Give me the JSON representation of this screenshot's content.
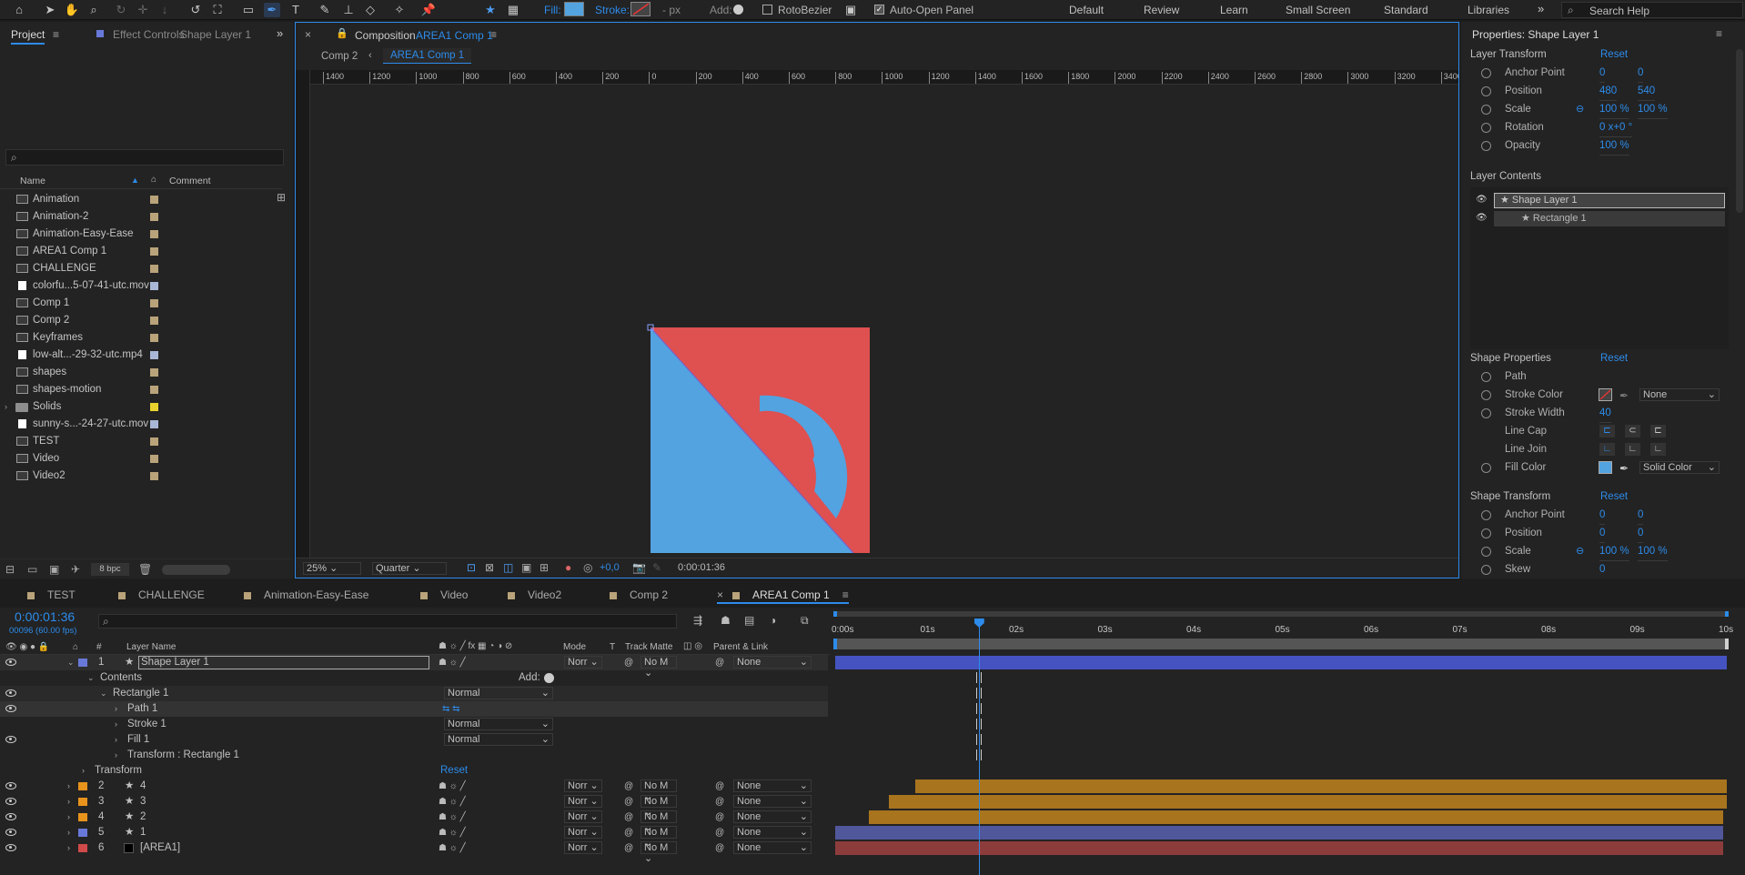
{
  "toolbar": {
    "fill_label": "Fill:",
    "stroke_label": "Stroke:",
    "stroke_unit": "- px",
    "add_label": "Add:",
    "rotobezier": "RotoBezier",
    "auto_open": "Auto-Open Panel",
    "workspaces": [
      "Default",
      "Review",
      "Learn",
      "Small Screen",
      "Standard",
      "Libraries"
    ],
    "search_help": "Search Help"
  },
  "project": {
    "tab_project": "Project",
    "tab_effect": "Effect Controls",
    "tab_effect_layer": "Shape Layer 1",
    "col_name": "Name",
    "col_comment": "Comment",
    "bpc": "8 bpc",
    "items": [
      {
        "name": "Animation",
        "kind": "comp",
        "color": "#b9a37a"
      },
      {
        "name": "Animation-2",
        "kind": "comp",
        "color": "#b9a37a"
      },
      {
        "name": "Animation-Easy-Ease",
        "kind": "comp",
        "color": "#b9a37a"
      },
      {
        "name": "AREA1 Comp 1",
        "kind": "comp",
        "color": "#b9a37a"
      },
      {
        "name": "CHALLENGE",
        "kind": "comp",
        "color": "#b9a37a"
      },
      {
        "name": "colorfu...5-07-41-utc.mov",
        "kind": "video",
        "color": "#a9b7d6"
      },
      {
        "name": "Comp 1",
        "kind": "comp",
        "color": "#b9a37a"
      },
      {
        "name": "Comp 2",
        "kind": "comp",
        "color": "#b9a37a"
      },
      {
        "name": "Keyframes",
        "kind": "comp",
        "color": "#b9a37a"
      },
      {
        "name": "low-alt...-29-32-utc.mp4",
        "kind": "video",
        "color": "#a9b7d6"
      },
      {
        "name": "shapes",
        "kind": "comp",
        "color": "#b9a37a"
      },
      {
        "name": "shapes-motion",
        "kind": "comp",
        "color": "#b9a37a"
      },
      {
        "name": "Solids",
        "kind": "folder",
        "color": "#e8d22e"
      },
      {
        "name": "sunny-s...-24-27-utc.mov",
        "kind": "video",
        "color": "#a9b7d6"
      },
      {
        "name": "TEST",
        "kind": "comp",
        "color": "#b9a37a"
      },
      {
        "name": "Video",
        "kind": "comp",
        "color": "#b9a37a"
      },
      {
        "name": "Video2",
        "kind": "comp",
        "color": "#b9a37a"
      }
    ]
  },
  "composition": {
    "header_prefix": "Composition",
    "header_name": "AREA1 Comp 1",
    "crumb_1": "Comp 2",
    "crumb_2": "AREA1 Comp 1",
    "ruler_h": [
      "1400",
      "1200",
      "1000",
      "800",
      "600",
      "400",
      "200",
      "0",
      "200",
      "400",
      "600",
      "800",
      "1000",
      "1200",
      "1400",
      "1600",
      "1800",
      "2000",
      "2200",
      "2400",
      "2600",
      "2800",
      "3000",
      "3200",
      "3400"
    ],
    "zoom": "25%",
    "resolution": "Quarter",
    "exposure": "+0,0",
    "timecode": "0:00:01:36",
    "colors": {
      "red": "#df5050",
      "blue": "#52a3e0"
    }
  },
  "properties": {
    "title": "Properties: Shape Layer 1",
    "layer_transform": "Layer Transform",
    "reset": "Reset",
    "lt": [
      {
        "label": "Anchor Point",
        "v1": "0",
        "v2": "0"
      },
      {
        "label": "Position",
        "v1": "480",
        "v2": "540"
      },
      {
        "label": "Scale",
        "v1": "100 %",
        "v2": "100 %"
      },
      {
        "label": "Rotation",
        "v1": "0 x+0 °",
        "v2": ""
      },
      {
        "label": "Opacity",
        "v1": "100 %",
        "v2": ""
      }
    ],
    "layer_contents": "Layer Contents",
    "contents": [
      "Shape Layer 1",
      "Rectangle 1"
    ],
    "shape_properties": "Shape Properties",
    "sp": {
      "path": "Path",
      "stroke_color": "Stroke Color",
      "stroke_type": "None",
      "stroke_width": "Stroke Width",
      "stroke_width_val": "40",
      "line_cap": "Line Cap",
      "line_join": "Line Join",
      "fill_color": "Fill Color",
      "fill_type": "Solid Color"
    },
    "shape_transform": "Shape Transform",
    "st": [
      {
        "label": "Anchor Point",
        "v1": "0",
        "v2": "0"
      },
      {
        "label": "Position",
        "v1": "0",
        "v2": "0"
      },
      {
        "label": "Scale",
        "v1": "100 %",
        "v2": "100 %"
      },
      {
        "label": "Skew",
        "v1": "0",
        "v2": ""
      }
    ]
  },
  "timeline_tabs": [
    {
      "label": "TEST",
      "color": "#b9a37a"
    },
    {
      "label": "CHALLENGE",
      "color": "#b9a37a"
    },
    {
      "label": "Animation-Easy-Ease",
      "color": "#b9a37a"
    },
    {
      "label": "Video",
      "color": "#b9a37a"
    },
    {
      "label": "Video2",
      "color": "#b9a37a"
    },
    {
      "label": "Comp 2",
      "color": "#b9a37a"
    },
    {
      "label": "AREA1 Comp 1",
      "color": "#b9a37a"
    }
  ],
  "timeline": {
    "timecode": "0:00:01:36",
    "frames": "00096 (60.00 fps)",
    "col_layer_name": "Layer Name",
    "col_mode": "Mode",
    "col_t": "T",
    "col_track": "Track Matte",
    "col_parent": "Parent & Link",
    "ruler": [
      "0:00s",
      "01s",
      "02s",
      "03s",
      "04s",
      "05s",
      "06s",
      "07s",
      "08s",
      "09s",
      "10s"
    ],
    "contents_label": "Contents",
    "add_label": "Add:",
    "rect_label": "Rectangle 1",
    "path_label": "Path 1",
    "stroke_label": "Stroke 1",
    "fill_label": "Fill 1",
    "transform_rect": "Transform : Rectangle 1",
    "transform_label": "Transform",
    "reset": "Reset",
    "normal": "Normal",
    "layers": [
      {
        "num": "1",
        "name": "Shape Layer 1",
        "color": "#6878d8",
        "mode": "Norr",
        "matte": "No M",
        "parent": "None",
        "bar_color": "#4453c0",
        "start": 0.0,
        "end": 1.0
      },
      {
        "num": "2",
        "name": "4",
        "color": "#e8931c",
        "mode": "Norr",
        "matte": "No M",
        "parent": "None",
        "bar_color": "#a8741e",
        "start": 0.09,
        "end": 1.0
      },
      {
        "num": "3",
        "name": "3",
        "color": "#e8931c",
        "mode": "Norr",
        "matte": "No M",
        "parent": "None",
        "bar_color": "#a8741e",
        "start": 0.06,
        "end": 1.0
      },
      {
        "num": "4",
        "name": "2",
        "color": "#e8931c",
        "mode": "Norr",
        "matte": "No M",
        "parent": "None",
        "bar_color": "#a8741e",
        "start": 0.038,
        "end": 0.996
      },
      {
        "num": "5",
        "name": "1",
        "color": "#6878d8",
        "mode": "Norr",
        "matte": "No M",
        "parent": "None",
        "bar_color": "#50579a",
        "start": 0.0,
        "end": 0.996
      },
      {
        "num": "6",
        "name": "[AREA1]",
        "color": "#d04a4a",
        "mode": "Norr",
        "matte": "No M",
        "parent": "None",
        "bar_color": "#8d3c3c",
        "start": 0.0,
        "end": 0.996
      }
    ],
    "playhead_fraction": 0.161
  }
}
